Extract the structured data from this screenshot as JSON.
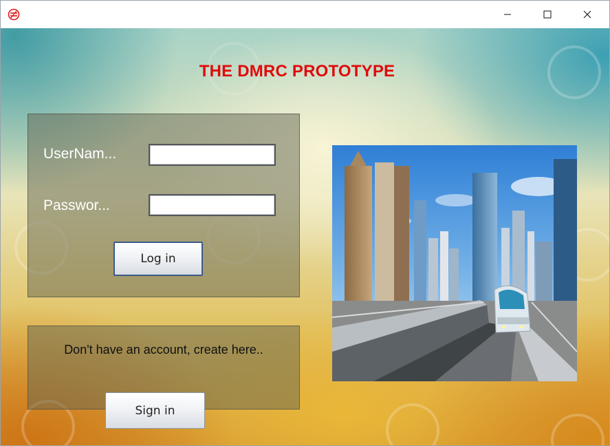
{
  "window": {
    "controls": {
      "minimize": "minimize-icon",
      "maximize": "maximize-icon",
      "close": "close-icon"
    },
    "app_icon": "dmrc-logo-icon"
  },
  "app": {
    "title": "THE DMRC PROTOTYPE"
  },
  "login": {
    "username_label": "UserNam...",
    "password_label": "Passwor...",
    "username_value": "",
    "password_value": "",
    "login_button": "Log in"
  },
  "signup": {
    "prompt": "Don't have an account, create here..",
    "signin_button": "Sign in"
  },
  "colors": {
    "title": "#e00b0b",
    "panel": "#646652",
    "metro_body": "#dfe8ee"
  },
  "image": {
    "description_icon": "metro-city-photo"
  }
}
